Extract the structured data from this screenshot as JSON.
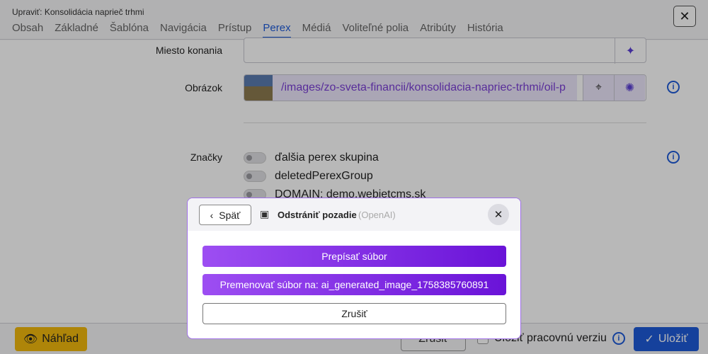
{
  "header": {
    "title": "Upraviť: Konsolidácia naprieč trhmi",
    "tabs": [
      {
        "label": "Obsah",
        "active": false
      },
      {
        "label": "Základné",
        "active": false
      },
      {
        "label": "Šablóna",
        "active": false
      },
      {
        "label": "Navigácia",
        "active": false
      },
      {
        "label": "Prístup",
        "active": false
      },
      {
        "label": "Perex",
        "active": true
      },
      {
        "label": "Médiá",
        "active": false
      },
      {
        "label": "Voliteľné polia",
        "active": false
      },
      {
        "label": "Atribúty",
        "active": false
      },
      {
        "label": "História",
        "active": false
      }
    ],
    "close_icon": "close-icon"
  },
  "form": {
    "venue_label": "Miesto konania",
    "venue_value": "",
    "image_label": "Obrázok",
    "image_path": "/images/zo-sveta-financii/konsolidacia-napriec-trhmi/oil-p",
    "tags_label": "Značky",
    "tags": [
      "ďalšia perex skupina",
      "deletedPerexGroup",
      "DOMAIN: demo.webjetcms.sk"
    ]
  },
  "footer": {
    "preview_label": "Náhľad",
    "cancel_label": "Zrušiť",
    "draft_label": "Uložiť pracovnú verziu",
    "save_label": "Uložiť"
  },
  "modal": {
    "back_label": "Späť",
    "title": "Odstrániť pozadie",
    "provider": "(OpenAI)",
    "overwrite_label": "Prepísať súbor",
    "rename_label": "Premenovať súbor na: ai_generated_image_1758385760891",
    "cancel_label": "Zrušiť"
  },
  "colors": {
    "accent": "#1e5bd8",
    "ai_purple": "#7a3fd6",
    "preview_yellow": "#f2b90d"
  }
}
